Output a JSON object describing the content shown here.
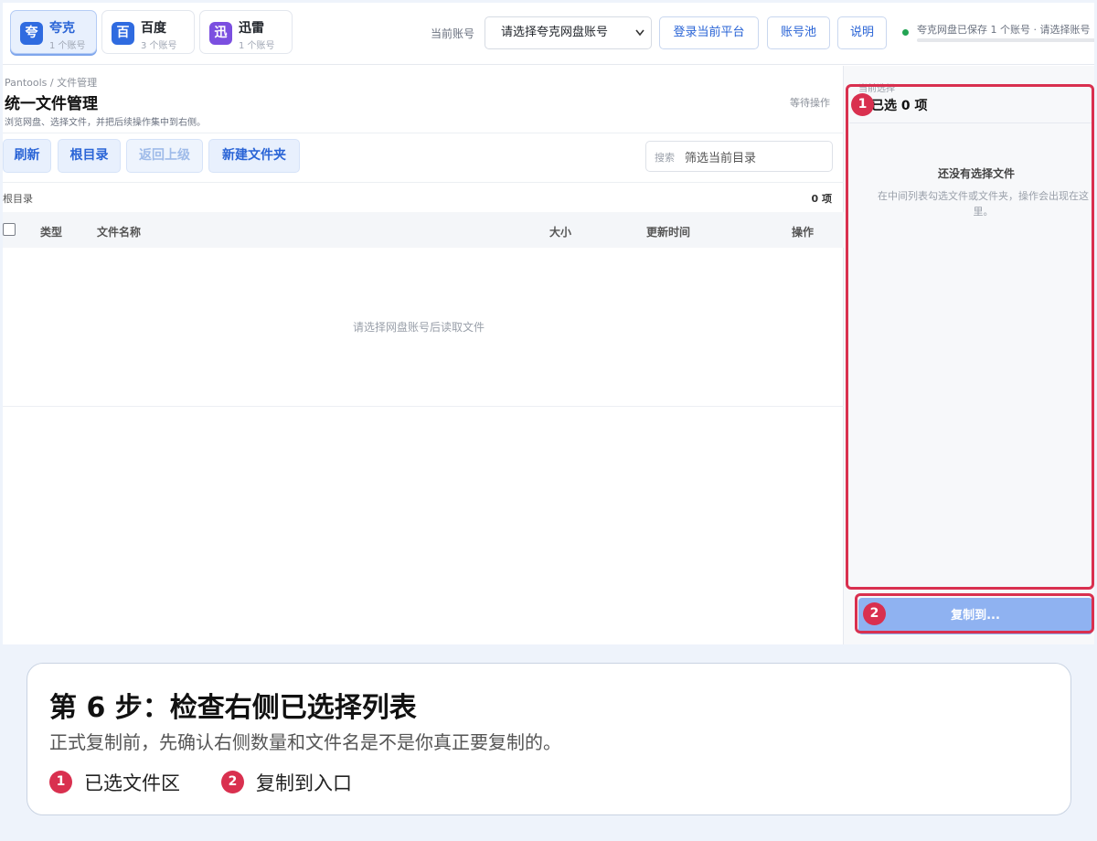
{
  "platforms": [
    {
      "icon_char": "夸",
      "name": "夸克",
      "count": "1 个账号",
      "color": "#2f6be0",
      "active": true
    },
    {
      "icon_char": "百",
      "name": "百度",
      "count": "3 个账号",
      "color": "#2f6be0",
      "active": false
    },
    {
      "icon_char": "迅",
      "name": "迅雷",
      "count": "1 个账号",
      "color": "#7b4fe0",
      "active": false
    }
  ],
  "header": {
    "account_label": "当前账号",
    "account_select": "请选择夸克网盘账号",
    "login_button": "登录当前平台",
    "pool_button": "账号池",
    "help_button": "说明",
    "status_text": "夸克网盘已保存 1 个账号 · 请选择账号"
  },
  "main": {
    "breadcrumb": "Pantools / 文件管理",
    "title": "统一文件管理",
    "subtitle": "浏览网盘、选择文件，并把后续操作集中到右侧。",
    "waiting": "等待操作",
    "toolbar": {
      "refresh": "刷新",
      "root": "根目录",
      "back": "返回上级",
      "new_folder": "新建文件夹",
      "search_label": "搜索",
      "search_placeholder": "筛选当前目录"
    },
    "path": "根目录",
    "count": "0 项",
    "columns": {
      "type": "类型",
      "name": "文件名称",
      "size": "大小",
      "updated": "更新时间",
      "action": "操作"
    },
    "empty_text": "请选择网盘账号后读取文件"
  },
  "side": {
    "caption": "当前选择",
    "count": "已选 0 项",
    "empty_title": "还没有选择文件",
    "empty_desc": "在中间列表勾选文件或文件夹，操作会出现在这里。",
    "copy_button": "复制到..."
  },
  "annotation": {
    "badge1": "1",
    "badge2": "2",
    "color": "#d9304f"
  },
  "caption": {
    "title": "第 6 步：检查右侧已选择列表",
    "desc": "正式复制前，先确认右侧数量和文件名是不是你真正要复制的。",
    "legend1": "已选文件区",
    "legend2": "复制到入口"
  }
}
